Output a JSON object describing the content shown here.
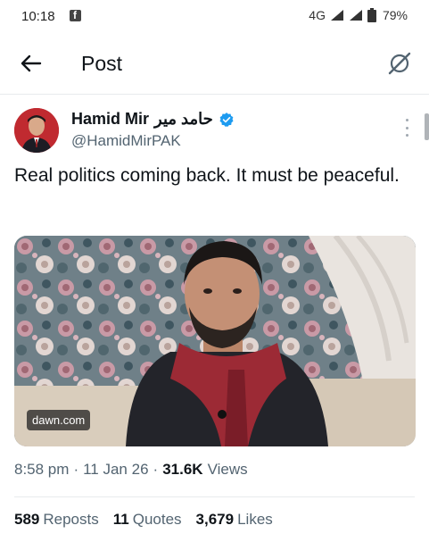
{
  "status_bar": {
    "time": "10:18",
    "network": "4G",
    "battery": "79%"
  },
  "app_bar": {
    "title": "Post"
  },
  "tweet": {
    "author_name": "Hamid Mir",
    "author_name_urdu": "حامد میر",
    "handle": "@HamidMirPAK",
    "text": "Real politics coming back. It must be peaceful.",
    "media_source": "dawn.com",
    "time": "8:58 pm",
    "date": "11 Jan 26",
    "views_count": "31.6K",
    "views_label": "Views",
    "reposts_count": "589",
    "reposts_label": "Reposts",
    "quotes_count": "11",
    "quotes_label": "Quotes",
    "likes_count": "3,679",
    "likes_label": "Likes"
  },
  "colors": {
    "accent": "#1d9bf0",
    "text_primary": "#0f1419",
    "text_secondary": "#536471",
    "avatar_bg": "#b8262b"
  }
}
